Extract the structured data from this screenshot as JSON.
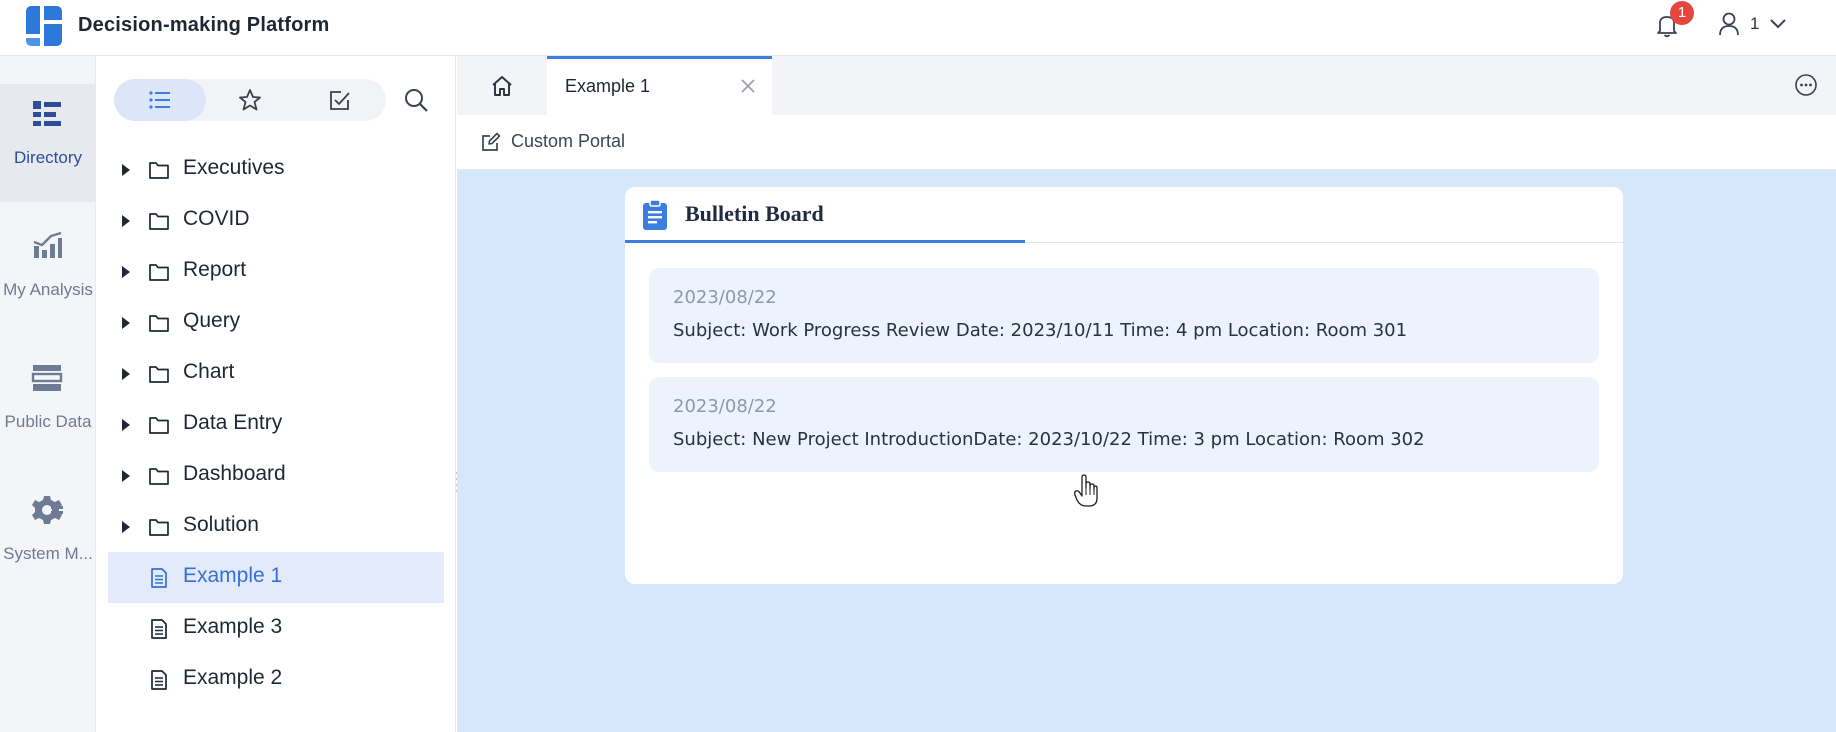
{
  "header": {
    "title": "Decision-making Platform",
    "notification_count": "1",
    "user_name": "1"
  },
  "rail": {
    "items": [
      {
        "label": "Directory",
        "icon": "directory-icon",
        "active": true
      },
      {
        "label": "My Analysis",
        "icon": "analysis-chart-icon",
        "active": false
      },
      {
        "label": "Public Data",
        "icon": "database-icon",
        "active": false
      },
      {
        "label": "System M...",
        "icon": "gear-icon",
        "active": false
      }
    ]
  },
  "tree": {
    "segment_tabs": [
      {
        "icon": "list-icon",
        "active": true
      },
      {
        "icon": "star-icon",
        "active": false
      },
      {
        "icon": "checked-box-icon",
        "active": false
      }
    ],
    "items": [
      {
        "label": "Executives",
        "type": "folder"
      },
      {
        "label": "COVID",
        "type": "folder"
      },
      {
        "label": "Report",
        "type": "folder"
      },
      {
        "label": "Query",
        "type": "folder"
      },
      {
        "label": "Chart",
        "type": "folder"
      },
      {
        "label": "Data Entry",
        "type": "folder"
      },
      {
        "label": "Dashboard",
        "type": "folder"
      },
      {
        "label": "Solution",
        "type": "folder"
      },
      {
        "label": "Example 1",
        "type": "file",
        "selected": true
      },
      {
        "label": "Example 3",
        "type": "file"
      },
      {
        "label": "Example 2",
        "type": "file"
      }
    ]
  },
  "tabs": {
    "active_tab": "Example 1"
  },
  "toolbar": {
    "custom_portal": "Custom Portal"
  },
  "bulletin": {
    "title": "Bulletin Board",
    "notices": [
      {
        "date": "2023/08/22",
        "text": "Subject: Work Progress Review Date: 2023/10/11 Time: 4 pm Location: Room 301"
      },
      {
        "date": "2023/08/22",
        "text": "Subject: New Project IntroductionDate: 2023/10/22 Time: 3 pm Location: Room 302"
      }
    ]
  },
  "colors": {
    "accent": "#3B7EE0",
    "brand": "#2C79DB",
    "selected_bg": "#E3EBFA",
    "main_bg": "#D6E6FB",
    "badge": "#E6463D"
  }
}
